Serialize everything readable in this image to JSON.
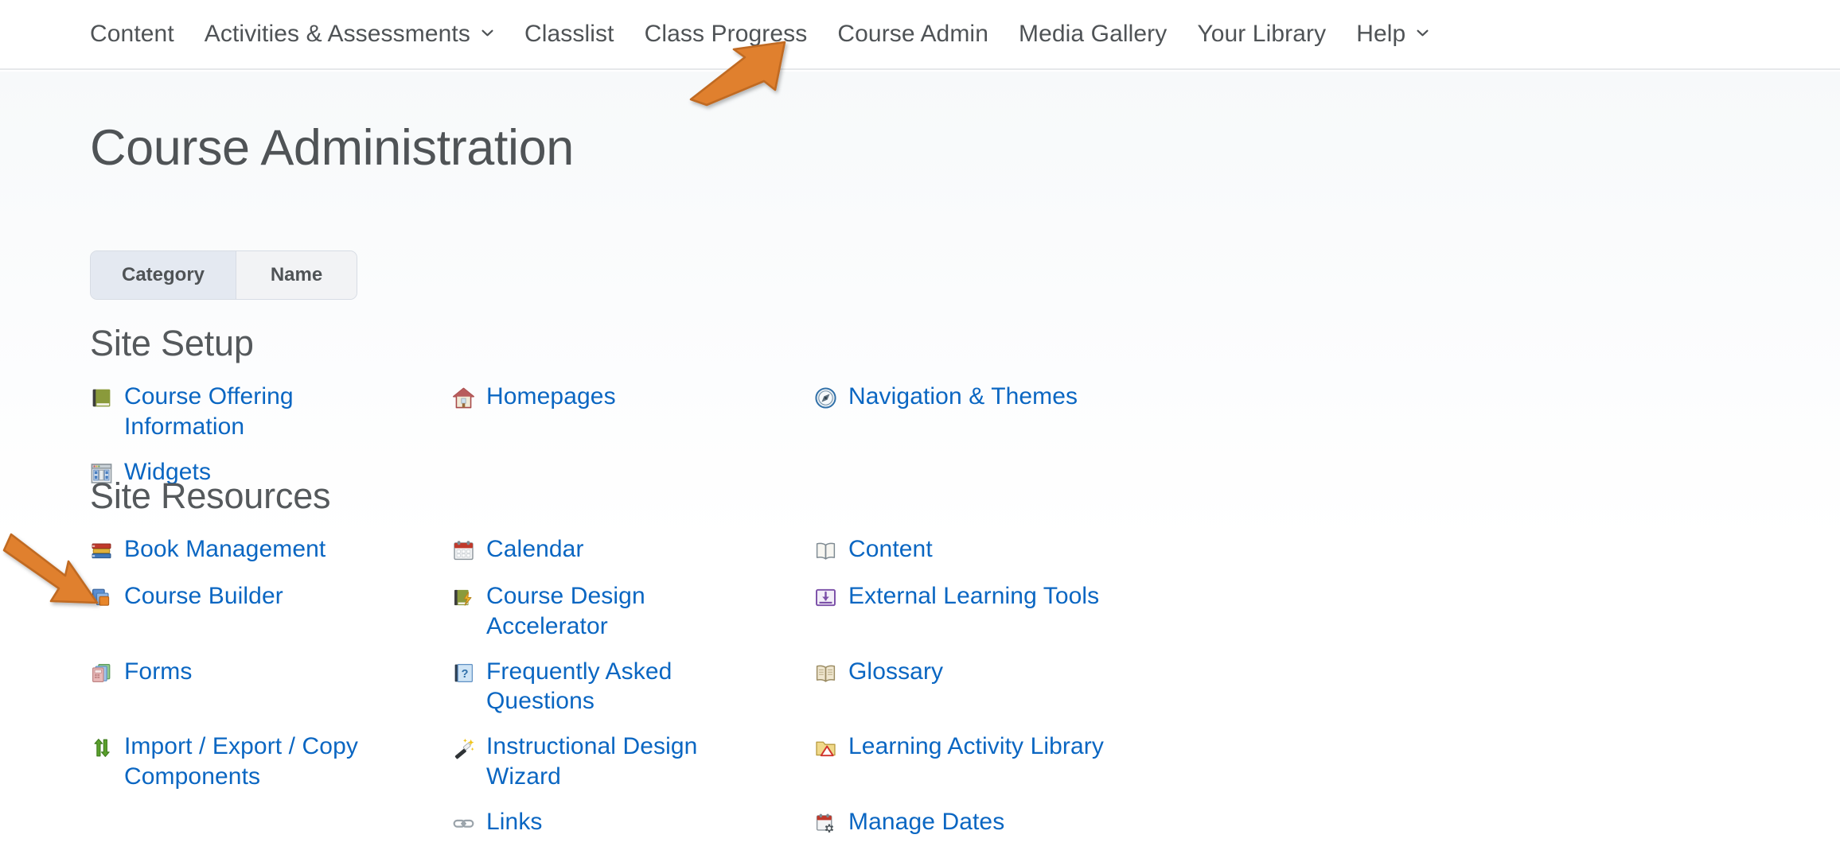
{
  "nav": {
    "items": [
      {
        "label": "Content",
        "has_caret": false,
        "icon": null
      },
      {
        "label": "Activities & Assessments",
        "has_caret": true,
        "icon": "chevron-down-icon"
      },
      {
        "label": "Classlist",
        "has_caret": false,
        "icon": null
      },
      {
        "label": "Class Progress",
        "has_caret": false,
        "icon": null
      },
      {
        "label": "Course Admin",
        "has_caret": false,
        "icon": null
      },
      {
        "label": "Media Gallery",
        "has_caret": false,
        "icon": null
      },
      {
        "label": "Your Library",
        "has_caret": false,
        "icon": null
      },
      {
        "label": "Help",
        "has_caret": true,
        "icon": "chevron-down-icon"
      }
    ]
  },
  "page": {
    "title": "Course Administration"
  },
  "view_switch": {
    "selected": "Category",
    "options": [
      {
        "label": "Category",
        "selected": true
      },
      {
        "label": "Name",
        "selected": false
      }
    ]
  },
  "sections": [
    {
      "title": "Site Setup",
      "items": [
        {
          "label": "Course Offering Information",
          "icon": "green-book-icon"
        },
        {
          "label": "Homepages",
          "icon": "house-icon"
        },
        {
          "label": "Navigation & Themes",
          "icon": "compass-icon"
        },
        {
          "label": "Widgets",
          "icon": "layout-widgets-icon"
        }
      ]
    },
    {
      "title": "Site Resources",
      "items": [
        {
          "label": "Book Management",
          "icon": "stacked-books-icon"
        },
        {
          "label": "Calendar",
          "icon": "calendar-icon"
        },
        {
          "label": "Content",
          "icon": "open-book-icon"
        },
        {
          "label": "Course Builder",
          "icon": "layered-squares-icon"
        },
        {
          "label": "Course Design Accelerator",
          "icon": "book-lightning-icon"
        },
        {
          "label": "External Learning Tools",
          "icon": "external-tool-icon"
        },
        {
          "label": "Forms",
          "icon": "forms-stack-icon"
        },
        {
          "label": "Frequently Asked Questions",
          "icon": "blue-question-book-icon"
        },
        {
          "label": "Glossary",
          "icon": "tan-open-book-icon"
        },
        {
          "label": "Import / Export / Copy Components",
          "icon": "up-down-arrows-icon"
        },
        {
          "label": "Instructional Design Wizard",
          "icon": "magic-wand-icon"
        },
        {
          "label": "Learning Activity Library",
          "icon": "folder-triangle-icon"
        },
        {
          "label": "Links",
          "icon": "chain-link-icon"
        },
        {
          "label": "Manage Dates",
          "icon": "calendar-gear-icon"
        }
      ]
    }
  ],
  "annotations": [
    {
      "name": "arrow-to-course-admin",
      "shape": "arrow",
      "color": "#e08030",
      "direction": "up-right",
      "points_to": "Course Admin"
    },
    {
      "name": "arrow-to-import-export",
      "shape": "arrow",
      "color": "#e08030",
      "direction": "down-right",
      "points_to": "Import / Export / Copy Components"
    }
  ],
  "colors": {
    "link": "#0a66c2",
    "nav_text": "#4f5356",
    "heading": "#55595c",
    "annotation": "#e08030",
    "tab_selected_bg": "#e4e9f1",
    "tab_bg": "#f2f3f5"
  }
}
